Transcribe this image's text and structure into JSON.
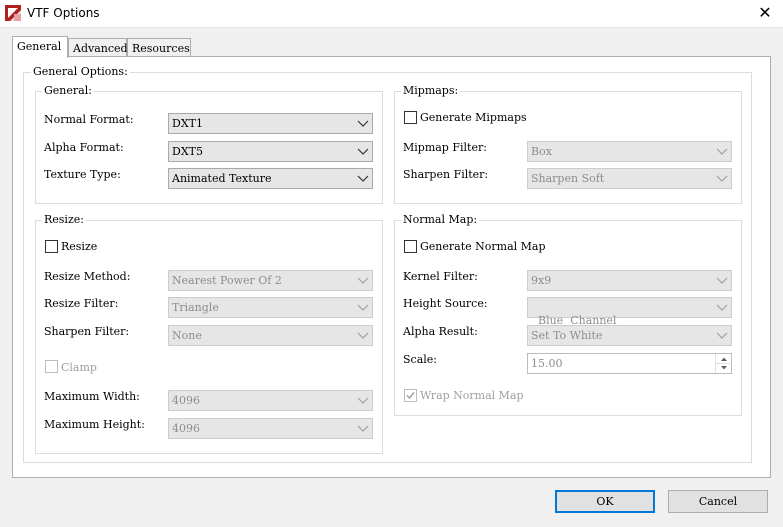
{
  "window": {
    "title": "VTF Options",
    "app_icon": "vtf-app-icon",
    "close_icon": "close-icon"
  },
  "tabs": [
    {
      "label": "General",
      "active": true
    },
    {
      "label": "Advanced",
      "active": false
    },
    {
      "label": "Resources",
      "active": false
    }
  ],
  "general_options": {
    "title": "General Options:",
    "general": {
      "title": "General:",
      "normal_format_label": "Normal Format:",
      "normal_format_value": "DXT1",
      "alpha_format_label": "Alpha Format:",
      "alpha_format_value": "DXT5",
      "texture_type_label": "Texture Type:",
      "texture_type_value": "Animated Texture"
    },
    "mipmaps": {
      "title": "Mipmaps:",
      "generate_label": "Generate Mipmaps",
      "generate_checked": false,
      "filter_label": "Mipmap Filter:",
      "filter_value": "Box",
      "sharpen_label": "Sharpen Filter:",
      "sharpen_value": "Sharpen Soft"
    },
    "resize": {
      "title": "Resize:",
      "resize_label": "Resize",
      "resize_checked": false,
      "method_label": "Resize Method:",
      "method_value": "Nearest Power Of 2",
      "filter_label": "Resize Filter:",
      "filter_value": "Triangle",
      "sharpen_label": "Sharpen Filter:",
      "sharpen_value": "None",
      "clamp_label": "Clamp",
      "clamp_checked": false,
      "max_width_label": "Maximum Width:",
      "max_width_value": "4096",
      "max_height_label": "Maximum Height:",
      "max_height_value": "4096"
    },
    "normal_map": {
      "title": "Normal Map:",
      "generate_label": "Generate Normal Map",
      "generate_checked": false,
      "kernel_label": "Kernel Filter:",
      "kernel_value": "9x9",
      "height_label": "Height Source:",
      "height_value": "Blue  Channel",
      "alpha_label": "Alpha Result:",
      "alpha_value": "Set To White",
      "scale_label": "Scale:",
      "scale_value": "15.00",
      "wrap_label": "Wrap Normal Map",
      "wrap_checked": true
    }
  },
  "buttons": {
    "ok": "OK",
    "cancel": "Cancel"
  }
}
